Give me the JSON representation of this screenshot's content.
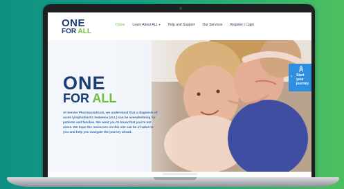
{
  "site": {
    "logo": {
      "one": "ONE",
      "for": "FOR ",
      "all": "ALL"
    },
    "nav": {
      "home": "Home",
      "learn": "Learn About ALL",
      "learn_caret": "▾",
      "help": "Help and Support",
      "services": "Our Services",
      "register": "Register | Login"
    }
  },
  "hero": {
    "title_one": "ONE",
    "title_for": "FOR ",
    "title_all": "ALL",
    "text": "At Servier Pharmaceuticals, we understand that a diagnosis of acute lymphoblastic leukemia (ALL) can be overwhelming for patients and families. We want you to know that you're not alone. We hope the resources on this site can be of value to you and help you navigate the journey ahead.",
    "journey": {
      "arrow": "‹",
      "line1": "Start",
      "line2": "your",
      "line3": "journey"
    }
  },
  "colors": {
    "navy": "#1a3e73",
    "green": "#6cbf3f",
    "blue_text": "#2f6db0",
    "journey_tab": "#2f8fde",
    "background_gradient": [
      "#0f8f82",
      "#4fbf5f"
    ]
  },
  "icons": {
    "journey": "rocket-icon"
  }
}
